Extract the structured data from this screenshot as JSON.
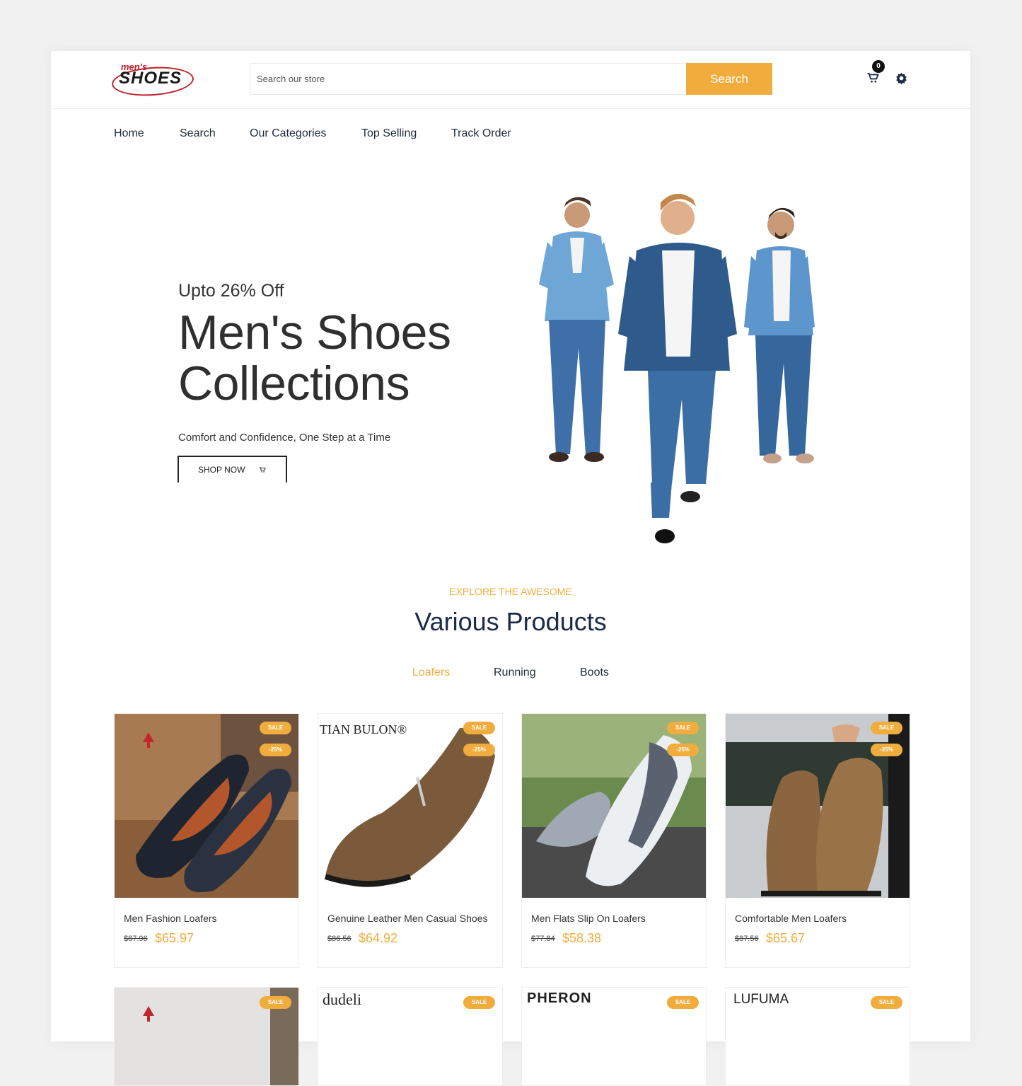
{
  "header": {
    "logo_top": "men's",
    "logo_main": "SHOES",
    "search_placeholder": "Search our store",
    "search_button": "Search",
    "cart_count": "0"
  },
  "nav": [
    "Home",
    "Search",
    "Our Categories",
    "Top Selling",
    "Track Order"
  ],
  "hero": {
    "subtitle": "Upto 26% Off",
    "title_line1": "Men's Shoes",
    "title_line2": "Collections",
    "tagline": "Comfort and Confidence, One Step at a Time",
    "button": "SHOP NOW"
  },
  "products_section": {
    "eyebrow": "EXPLORE THE AWESOME",
    "title": "Various Products",
    "tabs": [
      "Loafers",
      "Running",
      "Boots"
    ],
    "active_tab": "Loafers"
  },
  "products": [
    {
      "name": "Men Fashion Loafers",
      "old_price": "$87.96",
      "price": "$65.97",
      "sale": "SALE",
      "discount": "-25%",
      "brand": ""
    },
    {
      "name": "Genuine Leather Men Casual Shoes",
      "old_price": "$86.56",
      "price": "$64.92",
      "sale": "SALE",
      "discount": "-25%",
      "brand": "TIAN BULON®"
    },
    {
      "name": "Men Flats Slip On Loafers",
      "old_price": "$77.84",
      "price": "$58.38",
      "sale": "SALE",
      "discount": "-25%",
      "brand": ""
    },
    {
      "name": "Comfortable Men Loafers",
      "old_price": "$87.56",
      "price": "$65.67",
      "sale": "SALE",
      "discount": "-25%",
      "brand": ""
    }
  ],
  "products_row2": [
    {
      "sale": "SALE",
      "brand": ""
    },
    {
      "sale": "SALE",
      "brand": "dudeli"
    },
    {
      "sale": "SALE",
      "brand": "PHERON"
    },
    {
      "sale": "SALE",
      "brand": "LUFUMA"
    }
  ],
  "colors": {
    "accent": "#f0ad3d",
    "heading": "#1a2a4a",
    "logo_red": "#c01f27"
  },
  "icons": [
    "cart-icon",
    "gear-icon"
  ]
}
